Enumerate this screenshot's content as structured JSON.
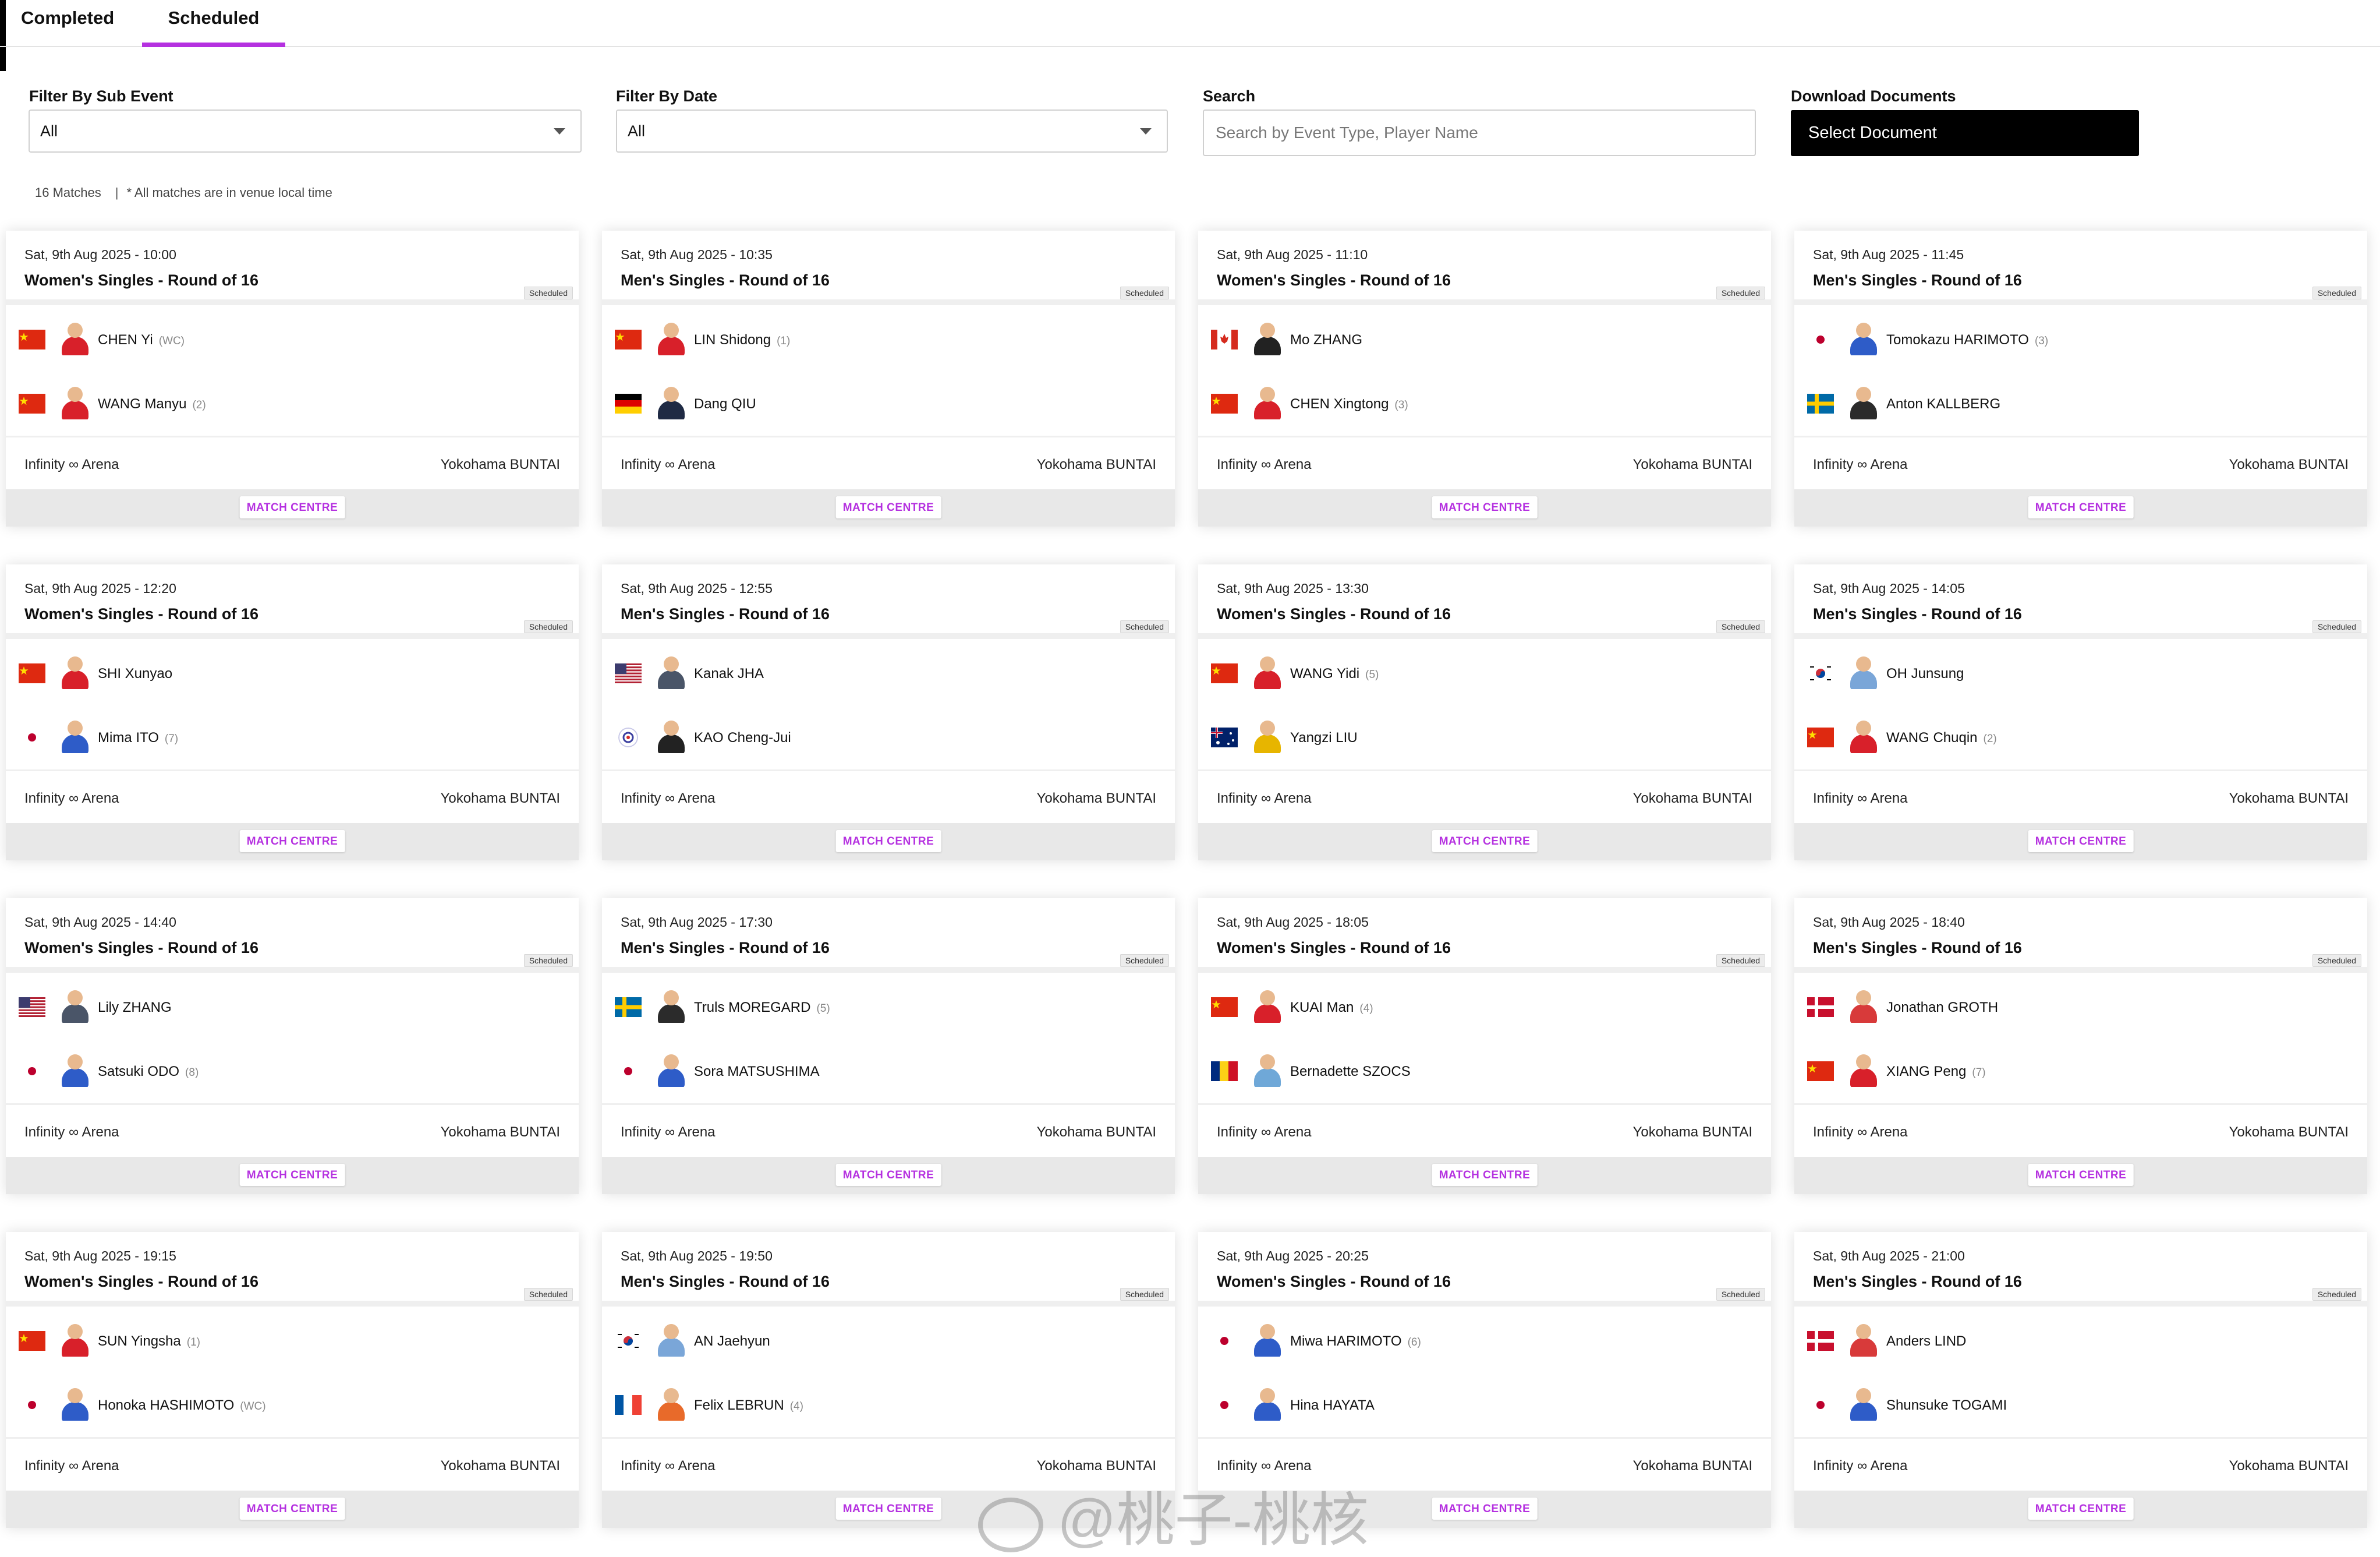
{
  "tabs": [
    {
      "label": "Completed",
      "active": false
    },
    {
      "label": "Scheduled",
      "active": true
    }
  ],
  "filters": {
    "sub_event": {
      "label": "Filter By Sub Event",
      "value": "All"
    },
    "date": {
      "label": "Filter By Date",
      "value": "All"
    },
    "search": {
      "label": "Search",
      "placeholder": "Search by Event Type, Player Name",
      "value": ""
    },
    "download": {
      "label": "Download Documents",
      "button": "Select Document"
    }
  },
  "summary": {
    "count": "16 Matches",
    "separator": "|",
    "note": "* All matches are in venue local time"
  },
  "colors": {
    "accent": "#b531e0"
  },
  "matches": [
    {
      "date": "Sat, 9th Aug 2025 - 10:00",
      "event": "Women's Singles - Round of 16",
      "status": "Scheduled",
      "venue": "Infinity ∞ Arena",
      "city": "Yokohama BUNTAI",
      "action": "MATCH CENTRE",
      "p1": {
        "name": "CHEN Yi",
        "seed": "(WC)",
        "flag": "CHN"
      },
      "p2": {
        "name": "WANG Manyu",
        "seed": "(2)",
        "flag": "CHN"
      }
    },
    {
      "date": "Sat, 9th Aug 2025 - 10:35",
      "event": "Men's Singles - Round of 16",
      "status": "Scheduled",
      "venue": "Infinity ∞ Arena",
      "city": "Yokohama BUNTAI",
      "action": "MATCH CENTRE",
      "p1": {
        "name": "LIN Shidong",
        "seed": "(1)",
        "flag": "CHN"
      },
      "p2": {
        "name": "Dang QIU",
        "seed": "",
        "flag": "GER"
      }
    },
    {
      "date": "Sat, 9th Aug 2025 - 11:10",
      "event": "Women's Singles - Round of 16",
      "status": "Scheduled",
      "venue": "Infinity ∞ Arena",
      "city": "Yokohama BUNTAI",
      "action": "MATCH CENTRE",
      "p1": {
        "name": "Mo ZHANG",
        "seed": "",
        "flag": "CAN"
      },
      "p2": {
        "name": "CHEN Xingtong",
        "seed": "(3)",
        "flag": "CHN"
      }
    },
    {
      "date": "Sat, 9th Aug 2025 - 11:45",
      "event": "Men's Singles - Round of 16",
      "status": "Scheduled",
      "venue": "Infinity ∞ Arena",
      "city": "Yokohama BUNTAI",
      "action": "MATCH CENTRE",
      "p1": {
        "name": "Tomokazu HARIMOTO",
        "seed": "(3)",
        "flag": "JPN"
      },
      "p2": {
        "name": "Anton KALLBERG",
        "seed": "",
        "flag": "SWE"
      }
    },
    {
      "date": "Sat, 9th Aug 2025 - 12:20",
      "event": "Women's Singles - Round of 16",
      "status": "Scheduled",
      "venue": "Infinity ∞ Arena",
      "city": "Yokohama BUNTAI",
      "action": "MATCH CENTRE",
      "p1": {
        "name": "SHI Xunyao",
        "seed": "",
        "flag": "CHN"
      },
      "p2": {
        "name": "Mima ITO",
        "seed": "(7)",
        "flag": "JPN"
      }
    },
    {
      "date": "Sat, 9th Aug 2025 - 12:55",
      "event": "Men's Singles - Round of 16",
      "status": "Scheduled",
      "venue": "Infinity ∞ Arena",
      "city": "Yokohama BUNTAI",
      "action": "MATCH CENTRE",
      "p1": {
        "name": "Kanak JHA",
        "seed": "",
        "flag": "USA"
      },
      "p2": {
        "name": "KAO Cheng-Jui",
        "seed": "",
        "flag": "TPE"
      }
    },
    {
      "date": "Sat, 9th Aug 2025 - 13:30",
      "event": "Women's Singles - Round of 16",
      "status": "Scheduled",
      "venue": "Infinity ∞ Arena",
      "city": "Yokohama BUNTAI",
      "action": "MATCH CENTRE",
      "p1": {
        "name": "WANG Yidi",
        "seed": "(5)",
        "flag": "CHN"
      },
      "p2": {
        "name": "Yangzi LIU",
        "seed": "",
        "flag": "AUS"
      }
    },
    {
      "date": "Sat, 9th Aug 2025 - 14:05",
      "event": "Men's Singles - Round of 16",
      "status": "Scheduled",
      "venue": "Infinity ∞ Arena",
      "city": "Yokohama BUNTAI",
      "action": "MATCH CENTRE",
      "p1": {
        "name": "OH Junsung",
        "seed": "",
        "flag": "KOR"
      },
      "p2": {
        "name": "WANG Chuqin",
        "seed": "(2)",
        "flag": "CHN"
      }
    },
    {
      "date": "Sat, 9th Aug 2025 - 14:40",
      "event": "Women's Singles - Round of 16",
      "status": "Scheduled",
      "venue": "Infinity ∞ Arena",
      "city": "Yokohama BUNTAI",
      "action": "MATCH CENTRE",
      "p1": {
        "name": "Lily ZHANG",
        "seed": "",
        "flag": "USA"
      },
      "p2": {
        "name": "Satsuki ODO",
        "seed": "(8)",
        "flag": "JPN"
      }
    },
    {
      "date": "Sat, 9th Aug 2025 - 17:30",
      "event": "Men's Singles - Round of 16",
      "status": "Scheduled",
      "venue": "Infinity ∞ Arena",
      "city": "Yokohama BUNTAI",
      "action": "MATCH CENTRE",
      "p1": {
        "name": "Truls MOREGARD",
        "seed": "(5)",
        "flag": "SWE"
      },
      "p2": {
        "name": "Sora MATSUSHIMA",
        "seed": "",
        "flag": "JPN"
      }
    },
    {
      "date": "Sat, 9th Aug 2025 - 18:05",
      "event": "Women's Singles - Round of 16",
      "status": "Scheduled",
      "venue": "Infinity ∞ Arena",
      "city": "Yokohama BUNTAI",
      "action": "MATCH CENTRE",
      "p1": {
        "name": "KUAI Man",
        "seed": "(4)",
        "flag": "CHN"
      },
      "p2": {
        "name": "Bernadette SZOCS",
        "seed": "",
        "flag": "ROU"
      }
    },
    {
      "date": "Sat, 9th Aug 2025 - 18:40",
      "event": "Men's Singles - Round of 16",
      "status": "Scheduled",
      "venue": "Infinity ∞ Arena",
      "city": "Yokohama BUNTAI",
      "action": "MATCH CENTRE",
      "p1": {
        "name": "Jonathan GROTH",
        "seed": "",
        "flag": "DEN"
      },
      "p2": {
        "name": "XIANG Peng",
        "seed": "(7)",
        "flag": "CHN"
      }
    },
    {
      "date": "Sat, 9th Aug 2025 - 19:15",
      "event": "Women's Singles - Round of 16",
      "status": "Scheduled",
      "venue": "Infinity ∞ Arena",
      "city": "Yokohama BUNTAI",
      "action": "MATCH CENTRE",
      "p1": {
        "name": "SUN Yingsha",
        "seed": "(1)",
        "flag": "CHN"
      },
      "p2": {
        "name": "Honoka HASHIMOTO",
        "seed": "(WC)",
        "flag": "JPN"
      }
    },
    {
      "date": "Sat, 9th Aug 2025 - 19:50",
      "event": "Men's Singles - Round of 16",
      "status": "Scheduled",
      "venue": "Infinity ∞ Arena",
      "city": "Yokohama BUNTAI",
      "action": "MATCH CENTRE",
      "p1": {
        "name": "AN Jaehyun",
        "seed": "",
        "flag": "KOR"
      },
      "p2": {
        "name": "Felix LEBRUN",
        "seed": "(4)",
        "flag": "FRA"
      }
    },
    {
      "date": "Sat, 9th Aug 2025 - 20:25",
      "event": "Women's Singles - Round of 16",
      "status": "Scheduled",
      "venue": "Infinity ∞ Arena",
      "city": "Yokohama BUNTAI",
      "action": "MATCH CENTRE",
      "p1": {
        "name": "Miwa HARIMOTO",
        "seed": "(6)",
        "flag": "JPN"
      },
      "p2": {
        "name": "Hina HAYATA",
        "seed": "",
        "flag": "JPN"
      }
    },
    {
      "date": "Sat, 9th Aug 2025 - 21:00",
      "event": "Men's Singles - Round of 16",
      "status": "Scheduled",
      "venue": "Infinity ∞ Arena",
      "city": "Yokohama BUNTAI",
      "action": "MATCH CENTRE",
      "p1": {
        "name": "Anders LIND",
        "seed": "",
        "flag": "DEN"
      },
      "p2": {
        "name": "Shunsuke TOGAMI",
        "seed": "",
        "flag": "JPN"
      }
    }
  ],
  "watermark": "@桃子-桃核"
}
